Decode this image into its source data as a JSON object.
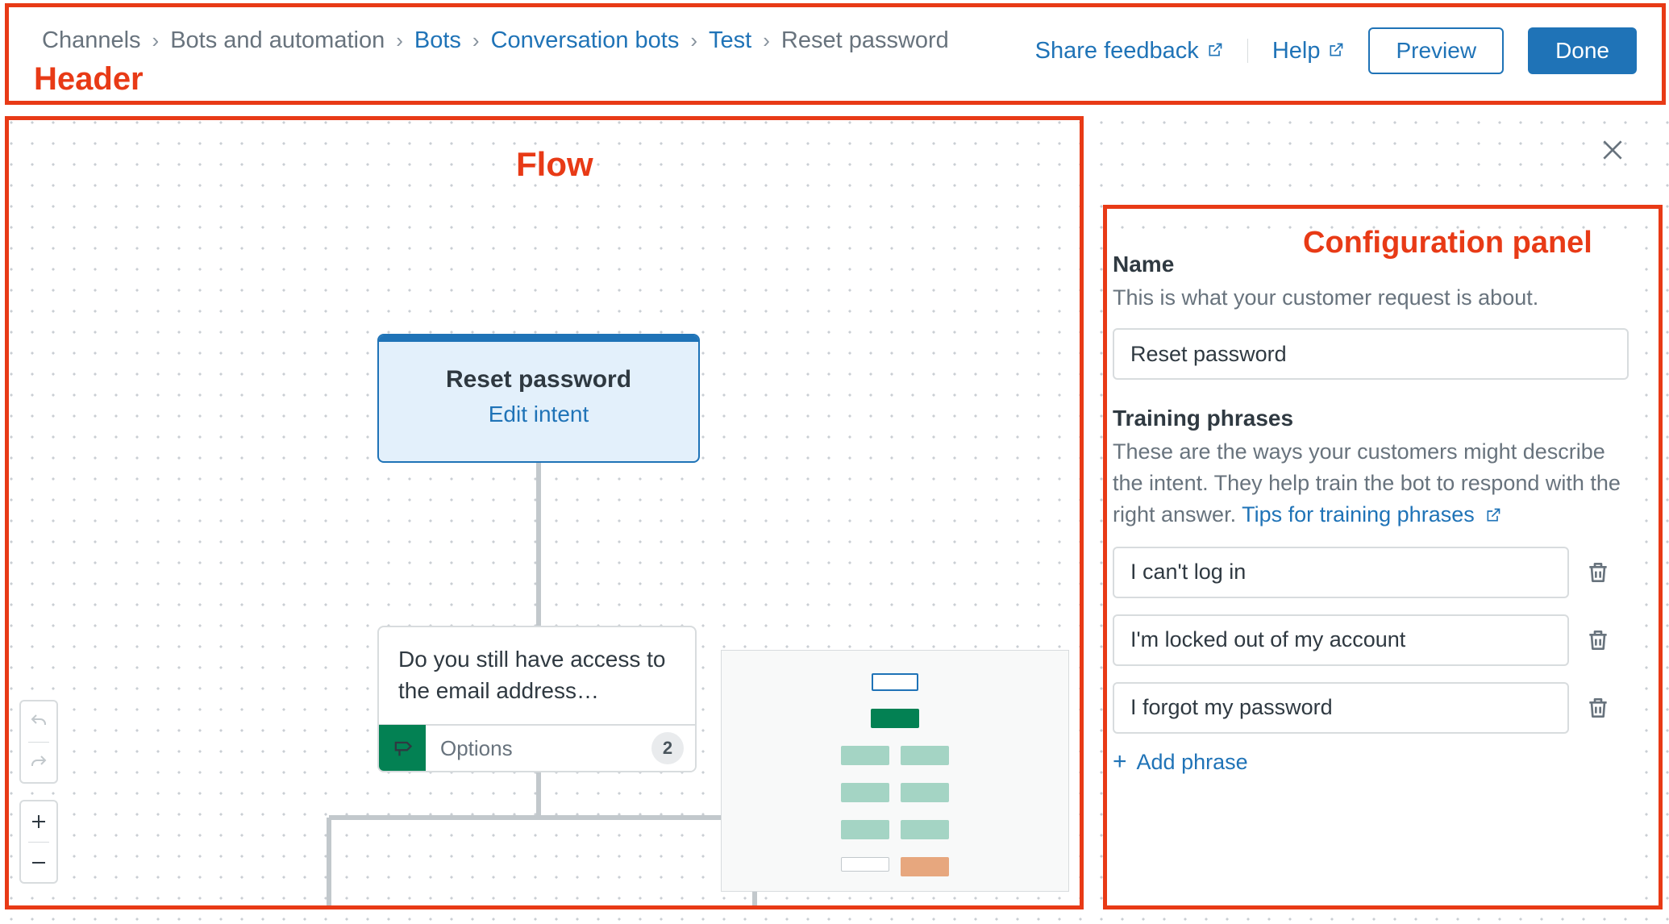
{
  "header": {
    "breadcrumbs": [
      {
        "label": "Channels",
        "link": false
      },
      {
        "label": "Bots and automation",
        "link": false
      },
      {
        "label": "Bots",
        "link": true
      },
      {
        "label": "Conversation bots",
        "link": true
      },
      {
        "label": "Test",
        "link": true
      },
      {
        "label": "Reset password",
        "link": false
      }
    ],
    "share_feedback": "Share feedback",
    "help": "Help",
    "preview": "Preview",
    "done": "Done"
  },
  "annotations": {
    "header": "Header",
    "flow": "Flow",
    "config": "Configuration panel"
  },
  "flow": {
    "intent": {
      "title": "Reset password",
      "edit_label": "Edit intent"
    },
    "message": {
      "text": "Do you still have access to the email address…",
      "options_label": "Options",
      "options_count": "2"
    }
  },
  "config": {
    "name_label": "Name",
    "name_desc": "This is what your customer request is about.",
    "name_value": "Reset password",
    "training_label": "Training phrases",
    "training_desc_pre": "These are the ways your customers might describe the intent. They help train the bot to respond with the right answer. ",
    "training_link": "Tips for training phrases",
    "phrases": [
      "I can't log in",
      "I'm locked out of my account",
      "I forgot my password"
    ],
    "add_phrase": "Add phrase"
  },
  "icons": {
    "external": "external-link-icon",
    "close": "close-icon",
    "trash": "trash-icon",
    "undo": "undo-icon",
    "redo": "redo-icon",
    "plus": "plus-icon",
    "minus": "minus-icon",
    "signpost": "signpost-icon"
  }
}
